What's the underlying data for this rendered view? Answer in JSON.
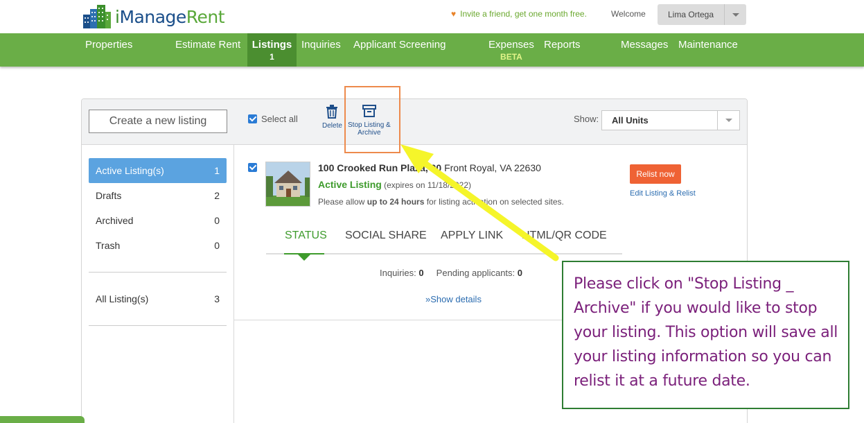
{
  "header": {
    "logo_prefix": "i",
    "logo_manage": "Manage",
    "logo_rent": "Rent",
    "invite": "Invite a friend, get one month free.",
    "welcome": "Welcome",
    "user_name": "Lima Ortega"
  },
  "nav": {
    "items": [
      {
        "label": "Properties"
      },
      {
        "label": "Estimate Rent"
      },
      {
        "label": "Listings",
        "badge": "1"
      },
      {
        "label": "Inquiries"
      },
      {
        "label": "Applicant Screening"
      },
      {
        "label": "Expenses",
        "badge": "BETA"
      },
      {
        "label": "Reports"
      },
      {
        "label": "Messages"
      },
      {
        "label": "Maintenance"
      }
    ]
  },
  "toolbar": {
    "create_label": "Create a new listing",
    "select_all": "Select all",
    "delete_label": "Delete",
    "stop_label_1": "Stop Listing &",
    "stop_label_2": "Archive",
    "show_label": "Show:",
    "show_value": "All Units"
  },
  "sidebar": {
    "items": [
      {
        "label": "Active Listing(s)",
        "count": "1"
      },
      {
        "label": "Drafts",
        "count": "2"
      },
      {
        "label": "Archived",
        "count": "0"
      },
      {
        "label": "Trash",
        "count": "0"
      },
      {
        "label": "All Listing(s)",
        "count": "3"
      }
    ]
  },
  "listing": {
    "address_bold": "100 Crooked Run Plaza, 00",
    "address_rest": " Front Royal, VA 22630",
    "status": "Active Listing",
    "expires": " (expires on 11/18/2022)",
    "allow_pre": "Please allow ",
    "allow_bold": "up to 24 hours",
    "allow_post": " for listing activation on selected sites.",
    "relist": "Relist now",
    "edit": "Edit Listing & Relist",
    "tabs": [
      {
        "label": "STATUS"
      },
      {
        "label": "SOCIAL SHARE"
      },
      {
        "label": "APPLY LINK"
      },
      {
        "label": "HTML/QR CODE"
      }
    ],
    "inquiries_label": "Inquiries: ",
    "inquiries_count": "0",
    "pending_label": "Pending applicants: ",
    "pending_count": "0",
    "show_details": "Show details"
  },
  "callout": {
    "text": "Please click on \"Stop Listing _ Archive\" if you would like to stop your listing. This option will save all your listing information so you  can relist it at a future date."
  },
  "colors": {
    "nav_green": "#6aae47",
    "nav_active": "#4b8e30",
    "active_blue": "#5ba3e0",
    "relist_orange": "#ef6234",
    "arrow_yellow": "#f5f52a",
    "callout_text": "#7a1f7a"
  }
}
